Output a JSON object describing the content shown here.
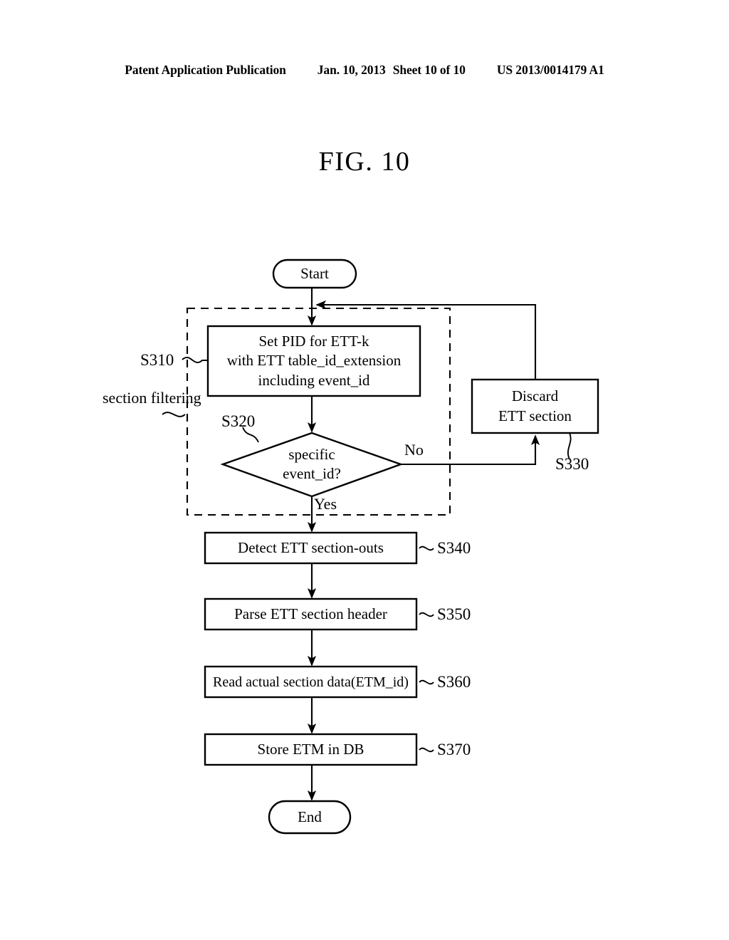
{
  "header": {
    "publication": "Patent Application Publication",
    "date": "Jan. 10, 2013",
    "sheet": "Sheet 10 of 10",
    "number": "US 2013/0014179 A1"
  },
  "figure": {
    "title": "FIG. 10"
  },
  "diagram": {
    "type": "flowchart",
    "start_label": "Start",
    "end_label": "End",
    "group_label": "section\nfiltering",
    "nodes": [
      {
        "id": "start",
        "shape": "terminator",
        "label": "Start"
      },
      {
        "id": "S310",
        "shape": "process",
        "label": "Set PID for ETT-k\nwith ETT table_id_extension\nincluding event_id",
        "step": "S310"
      },
      {
        "id": "S320",
        "shape": "decision",
        "label": "specific\nevent_id?",
        "step": "S320"
      },
      {
        "id": "S330",
        "shape": "process",
        "label": "Discard\nETT section",
        "step": "S330"
      },
      {
        "id": "S340",
        "shape": "process",
        "label": "Detect ETT section-outs",
        "step": "S340"
      },
      {
        "id": "S350",
        "shape": "process",
        "label": "Parse ETT section header",
        "step": "S350"
      },
      {
        "id": "S360",
        "shape": "process",
        "label": "Read actual section data(ETM_id)",
        "step": "S360"
      },
      {
        "id": "S370",
        "shape": "process",
        "label": "Store ETM in DB",
        "step": "S370"
      },
      {
        "id": "end",
        "shape": "terminator",
        "label": "End"
      }
    ],
    "branch_labels": {
      "no": "No",
      "yes": "Yes"
    },
    "colors": {
      "stroke": "#000000",
      "background": "#ffffff"
    }
  }
}
